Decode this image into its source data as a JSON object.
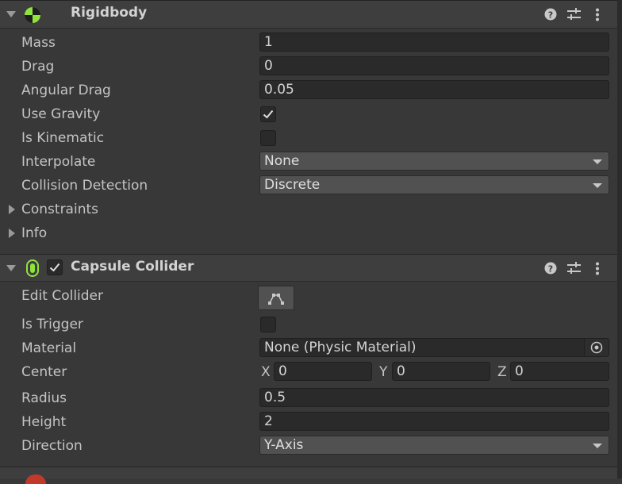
{
  "rigidbody": {
    "title": "Rigidbody",
    "fields": {
      "mass": {
        "label": "Mass",
        "value": "1"
      },
      "drag": {
        "label": "Drag",
        "value": "0"
      },
      "angular_drag": {
        "label": "Angular Drag",
        "value": "0.05"
      },
      "use_gravity": {
        "label": "Use Gravity",
        "checked": true
      },
      "is_kinematic": {
        "label": "Is Kinematic",
        "checked": false
      },
      "interpolate": {
        "label": "Interpolate",
        "value": "None"
      },
      "collision_detection": {
        "label": "Collision Detection",
        "value": "Discrete"
      }
    },
    "foldouts": {
      "constraints": "Constraints",
      "info": "Info"
    }
  },
  "capsule_collider": {
    "title": "Capsule Collider",
    "enabled": true,
    "fields": {
      "edit_collider": {
        "label": "Edit Collider"
      },
      "is_trigger": {
        "label": "Is Trigger",
        "checked": false
      },
      "material": {
        "label": "Material",
        "value": "None (Physic Material)"
      },
      "center": {
        "label": "Center",
        "x_label": "X",
        "x": "0",
        "y_label": "Y",
        "y": "0",
        "z_label": "Z",
        "z": "0"
      },
      "radius": {
        "label": "Radius",
        "value": "0.5"
      },
      "height": {
        "label": "Height",
        "value": "2"
      },
      "direction": {
        "label": "Direction",
        "value": "Y-Axis"
      }
    }
  },
  "colors": {
    "panel_bg": "#383838",
    "header_bg": "#3e3e3e",
    "rigidbody_icon": "#8fe33b",
    "capsule_icon": "#8fe33b"
  },
  "icons": [
    "rigidbody-icon",
    "capsule-collider-icon",
    "help-icon",
    "presets-icon",
    "more-icon",
    "edit-collider-icon",
    "object-picker-icon",
    "checkmark-icon"
  ]
}
